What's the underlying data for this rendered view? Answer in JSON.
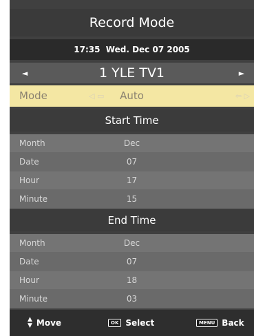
{
  "title": "Record Mode",
  "datetime": "17:35  Wed. Dec 07 2005",
  "channel": {
    "name": "1 YLE TV1",
    "left_arrow": "◄",
    "right_arrow": "►"
  },
  "mode": {
    "label": "Mode",
    "value": "Auto",
    "left_indicator": "◁ ▭",
    "right_indicator": "⇦ ▷"
  },
  "start_time": {
    "header": "Start Time",
    "rows": [
      {
        "label": "Month",
        "value": "Dec"
      },
      {
        "label": "Date",
        "value": "07"
      },
      {
        "label": "Hour",
        "value": "17"
      },
      {
        "label": "Minute",
        "value": "15"
      }
    ]
  },
  "end_time": {
    "header": "End Time",
    "rows": [
      {
        "label": "Month",
        "value": "Dec"
      },
      {
        "label": "Date",
        "value": "07"
      },
      {
        "label": "Hour",
        "value": "18"
      },
      {
        "label": "Minute",
        "value": "03"
      }
    ]
  },
  "footer": {
    "move_label": "Move",
    "select_key": "OK",
    "select_label": "Select",
    "back_key": "MENU",
    "back_label": "Back"
  }
}
